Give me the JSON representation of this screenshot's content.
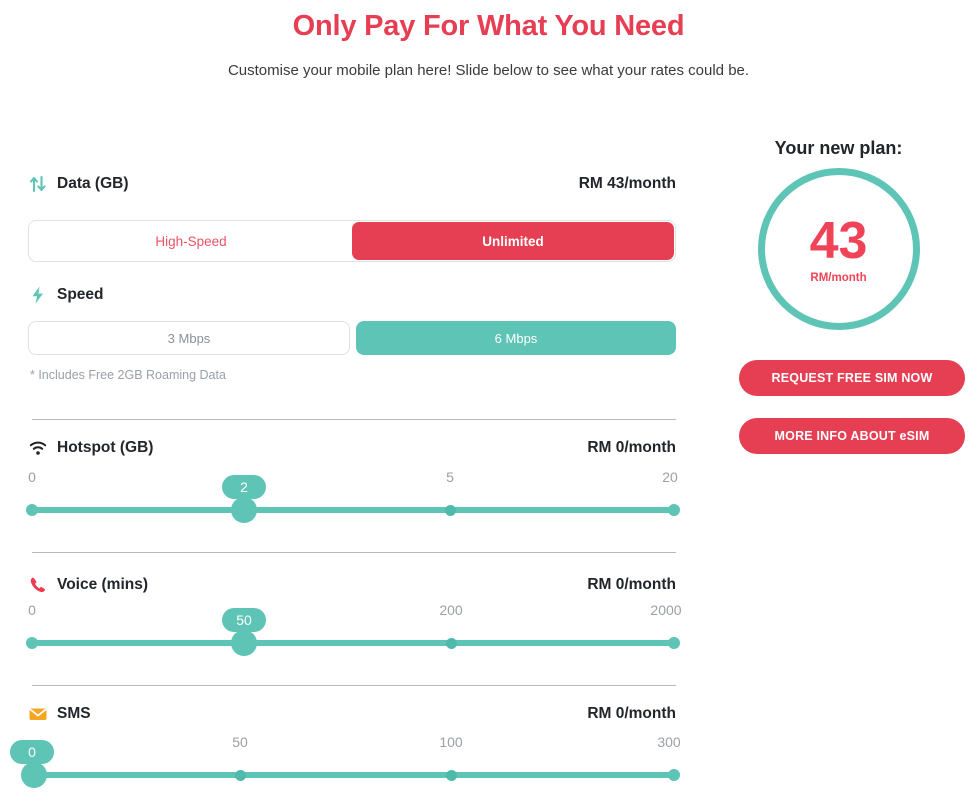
{
  "header": {
    "title": "Only Pay For What You Need",
    "subtitle": "Customise your mobile plan here! Slide below to see what your rates could be."
  },
  "colors": {
    "brand_red": "#e63e52",
    "brand_teal": "#5ec4b6",
    "muted_gray": "#9aa0a6",
    "sms_orange": "#f5a623"
  },
  "data_section": {
    "icon": "data-transfer-icon",
    "label": "Data (GB)",
    "price": "RM 43/month",
    "options": [
      {
        "label": "High-Speed",
        "selected": false
      },
      {
        "label": "Unlimited",
        "selected": true
      }
    ]
  },
  "speed_section": {
    "icon": "lightning-bolt-icon",
    "label": "Speed",
    "options": [
      {
        "label": "3 Mbps",
        "selected": false
      },
      {
        "label": "6 Mbps",
        "selected": true
      }
    ],
    "note": "* Includes Free 2GB Roaming Data"
  },
  "hotspot_section": {
    "icon": "wifi-icon",
    "label": "Hotspot (GB)",
    "price": "RM 0/month",
    "slider": {
      "value": "2",
      "value_pos_pct": 33,
      "ticks": [
        {
          "label": "0",
          "pos_pct": 0
        },
        {
          "label": "5",
          "pos_pct": 65
        },
        {
          "label": "20",
          "pos_pct": 100
        }
      ]
    }
  },
  "voice_section": {
    "icon": "phone-icon",
    "label": "Voice (mins)",
    "price": "RM 0/month",
    "slider": {
      "value": "50",
      "value_pos_pct": 33,
      "ticks": [
        {
          "label": "0",
          "pos_pct": 0
        },
        {
          "label": "200",
          "pos_pct": 65
        },
        {
          "label": "2000",
          "pos_pct": 100
        }
      ]
    }
  },
  "sms_section": {
    "icon": "envelope-icon",
    "label": "SMS",
    "price": "RM 0/month",
    "slider": {
      "value": "0",
      "value_pos_pct": 0,
      "ticks": [
        {
          "label": "50",
          "pos_pct": 32.5
        },
        {
          "label": "100",
          "pos_pct": 65
        },
        {
          "label": "300",
          "pos_pct": 100
        }
      ]
    }
  },
  "plan_panel": {
    "title": "Your new plan:",
    "amount": "43",
    "unit": "RM/month",
    "primary_button": "REQUEST FREE SIM NOW",
    "secondary_button": "MORE INFO ABOUT eSIM"
  }
}
